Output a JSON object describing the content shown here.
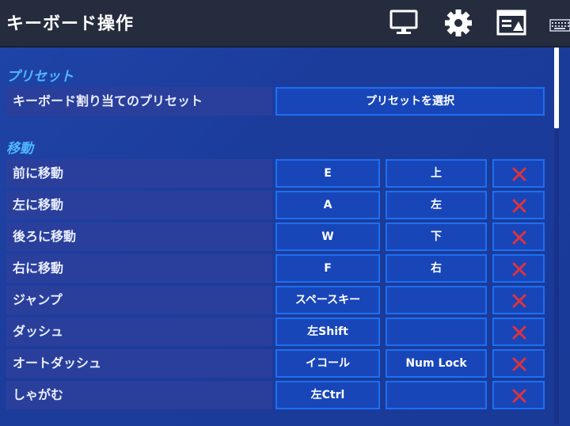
{
  "header": {
    "title": "キーボード操作",
    "icons": [
      "monitor-icon",
      "gear-icon",
      "display-settings-icon",
      "keyboard-icon"
    ]
  },
  "sections": {
    "preset": {
      "title": "プリセット",
      "row_label": "キーボード割り当てのプリセット",
      "button_label": "プリセットを選択"
    },
    "movement": {
      "title": "移動",
      "rows": [
        {
          "label": "前に移動",
          "key1": "E",
          "key2": "上"
        },
        {
          "label": "左に移動",
          "key1": "A",
          "key2": "左"
        },
        {
          "label": "後ろに移動",
          "key1": "W",
          "key2": "下"
        },
        {
          "label": "右に移動",
          "key1": "F",
          "key2": "右"
        },
        {
          "label": "ジャンプ",
          "key1": "スペースキー",
          "key2": ""
        },
        {
          "label": "ダッシュ",
          "key1": "左Shift",
          "key2": ""
        },
        {
          "label": "オートダッシュ",
          "key1": "イコール",
          "key2": "Num Lock"
        },
        {
          "label": "しゃがむ",
          "key1": "左Ctrl",
          "key2": ""
        }
      ]
    }
  },
  "colors": {
    "accent": "#4fb6ff",
    "clear_x": "#e0323c",
    "topbar": "#252c3e"
  }
}
